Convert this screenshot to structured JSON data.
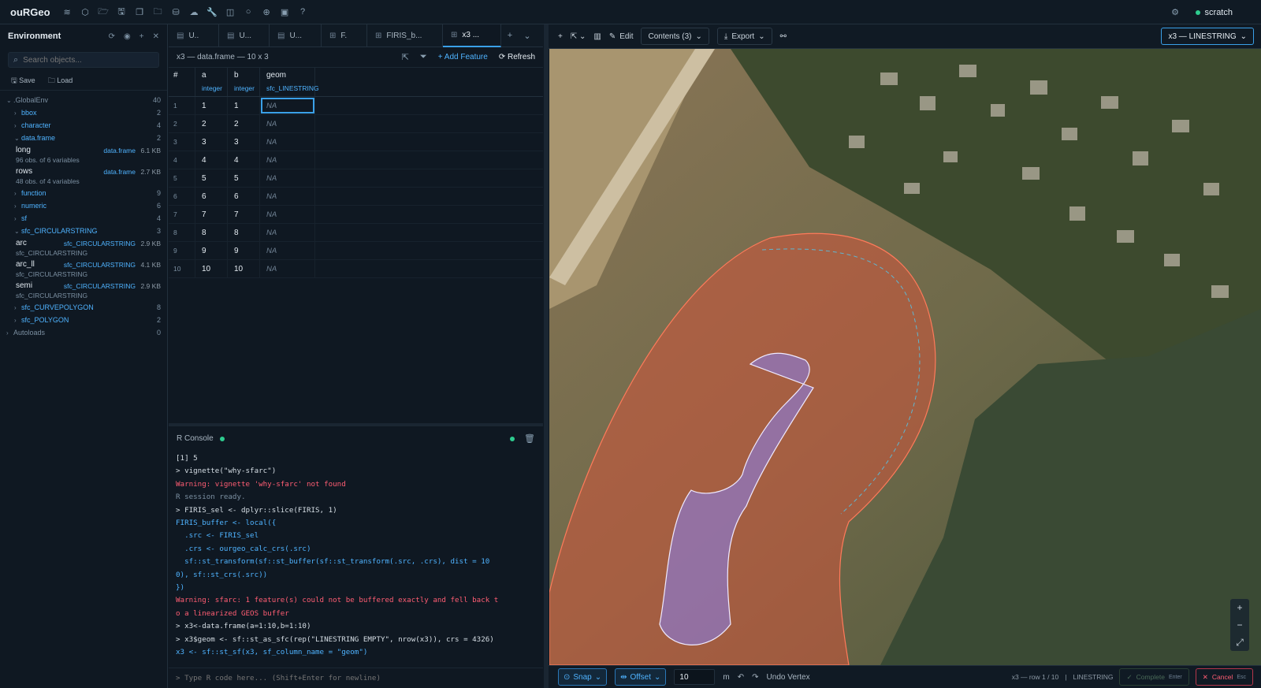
{
  "app": {
    "title": "ouRGeo",
    "workspace": "scratch"
  },
  "toolbar_icons": [
    "layers-icon",
    "cube-icon",
    "folder-open-icon",
    "save-icon",
    "copy-icon",
    "folder-icon",
    "database-icon",
    "cloud-icon",
    "wrench-icon",
    "robot-icon",
    "circle-icon",
    "globe-icon",
    "image-icon",
    "help-icon"
  ],
  "environment": {
    "title": "Environment",
    "search_placeholder": "Search objects...",
    "save_label": "Save",
    "load_label": "Load",
    "tree": [
      {
        "kind": "group",
        "label": ".GlobalEnv",
        "count": "40",
        "level": 0,
        "open": true
      },
      {
        "kind": "group",
        "label": "bbox",
        "count": "2",
        "level": 1,
        "open": false
      },
      {
        "kind": "group",
        "label": "character",
        "count": "4",
        "level": 1,
        "open": false
      },
      {
        "kind": "group",
        "label": "data.frame",
        "count": "2",
        "level": 1,
        "open": true
      },
      {
        "kind": "obj",
        "name": "long",
        "type": "data.frame",
        "size": "6.1 KB",
        "sub": "96 obs. of 6 variables"
      },
      {
        "kind": "obj",
        "name": "rows",
        "type": "data.frame",
        "size": "2.7 KB",
        "sub": "48 obs. of 4 variables"
      },
      {
        "kind": "group",
        "label": "function",
        "count": "9",
        "level": 1,
        "open": false
      },
      {
        "kind": "group",
        "label": "numeric",
        "count": "6",
        "level": 1,
        "open": false
      },
      {
        "kind": "group",
        "label": "sf",
        "count": "4",
        "level": 1,
        "open": false
      },
      {
        "kind": "group",
        "label": "sfc_CIRCULARSTRING",
        "count": "3",
        "level": 1,
        "open": true
      },
      {
        "kind": "obj",
        "name": "arc",
        "type": "sfc_CIRCULARSTRING",
        "size": "2.9 KB",
        "sub": "sfc_CIRCULARSTRING"
      },
      {
        "kind": "obj",
        "name": "arc_ll",
        "type": "sfc_CIRCULARSTRING",
        "size": "4.1 KB",
        "sub": "sfc_CIRCULARSTRING"
      },
      {
        "kind": "obj",
        "name": "semi",
        "type": "sfc_CIRCULARSTRING",
        "size": "2.9 KB",
        "sub": "sfc_CIRCULARSTRING"
      },
      {
        "kind": "group",
        "label": "sfc_CURVEPOLYGON",
        "count": "8",
        "level": 1,
        "open": false
      },
      {
        "kind": "group",
        "label": "sfc_POLYGON",
        "count": "2",
        "level": 1,
        "open": false
      },
      {
        "kind": "group",
        "label": "Autoloads",
        "count": "0",
        "level": 0,
        "open": false
      }
    ]
  },
  "tabs": [
    {
      "label": "U..",
      "icon": "file-icon",
      "active": false
    },
    {
      "label": "U...",
      "icon": "file-icon",
      "active": false
    },
    {
      "label": "U...",
      "icon": "file-icon",
      "active": false
    },
    {
      "label": "F.",
      "icon": "table-icon",
      "active": false
    },
    {
      "label": "FIRIS_b...",
      "icon": "table-icon",
      "active": false
    },
    {
      "label": "x3 ...",
      "icon": "table-icon",
      "active": true
    }
  ],
  "dataview": {
    "title": "x3 — data.frame — 10 x 3",
    "add_feature": "+ Add Feature",
    "refresh": "Refresh",
    "columns": [
      {
        "name": "#",
        "type": ""
      },
      {
        "name": "a",
        "type": "integer"
      },
      {
        "name": "b",
        "type": "integer"
      },
      {
        "name": "geom",
        "type": "sfc_LINESTRING"
      }
    ],
    "rows": [
      [
        "1",
        "1",
        "1",
        "NA"
      ],
      [
        "2",
        "2",
        "2",
        "NA"
      ],
      [
        "3",
        "3",
        "3",
        "NA"
      ],
      [
        "4",
        "4",
        "4",
        "NA"
      ],
      [
        "5",
        "5",
        "5",
        "NA"
      ],
      [
        "6",
        "6",
        "6",
        "NA"
      ],
      [
        "7",
        "7",
        "7",
        "NA"
      ],
      [
        "8",
        "8",
        "8",
        "NA"
      ],
      [
        "9",
        "9",
        "9",
        "NA"
      ],
      [
        "10",
        "10",
        "10",
        "NA"
      ]
    ]
  },
  "console": {
    "title": "R Console",
    "input_placeholder": "> Type R code here... (Shift+Enter for newline)",
    "lines": [
      {
        "t": "out",
        "text": "[1] 5"
      },
      {
        "t": "cmd",
        "text": "> vignette(\"why-sfarc\")"
      },
      {
        "t": "warn",
        "text": "Warning: vignette 'why-sfarc' not found"
      },
      {
        "t": "info",
        "text": "R session ready."
      },
      {
        "t": "cmd",
        "text": "> FIRIS_sel <- dplyr::slice(FIRIS, 1)"
      },
      {
        "t": "cont",
        "text": "FIRIS_buffer <- local({"
      },
      {
        "t": "cont",
        "text": "  .src <- FIRIS_sel"
      },
      {
        "t": "cont",
        "text": "  .crs <- ourgeo_calc_crs(.src)"
      },
      {
        "t": "cont",
        "text": "  sf::st_transform(sf::st_buffer(sf::st_transform(.src, .crs), dist = 10"
      },
      {
        "t": "cont",
        "text": "0), sf::st_crs(.src))"
      },
      {
        "t": "cont",
        "text": "})"
      },
      {
        "t": "warn",
        "text": "Warning: sfarc: 1 feature(s) could not be buffered exactly and fell back t"
      },
      {
        "t": "warn",
        "text": "o a linearized GEOS buffer"
      },
      {
        "t": "cmd",
        "text": "> x3<-data.frame(a=1:10,b=1:10)"
      },
      {
        "t": "cmd",
        "text": "> x3$geom <- sf::st_as_sfc(rep(\"LINESTRING EMPTY\", nrow(x3)), crs = 4326)"
      },
      {
        "t": "cont",
        "text": "x3 <- sf::st_sf(x3, sf_column_name = \"geom\")"
      }
    ]
  },
  "map": {
    "edit_label": "Edit",
    "contents_label": "Contents (3)",
    "export_label": "Export",
    "layer_label": "x3 — LINESTRING",
    "snap_label": "Snap",
    "offset_label": "Offset",
    "offset_value": "10",
    "offset_unit": "m",
    "undo_vertex": "Undo Vertex",
    "status_row": "x3 — row 1 / 10",
    "status_type": "LINESTRING",
    "complete_label": "Complete",
    "complete_key": "Enter",
    "cancel_label": "Cancel",
    "cancel_key": "Esc",
    "colors": {
      "buffer_fill": "#d2553c",
      "buffer_stroke": "#ff7a5a",
      "selected_fill": "#8a7bd6",
      "selected_stroke": "#f0eaff",
      "water": "#2f4230",
      "accent": "#3aa0e8"
    }
  }
}
